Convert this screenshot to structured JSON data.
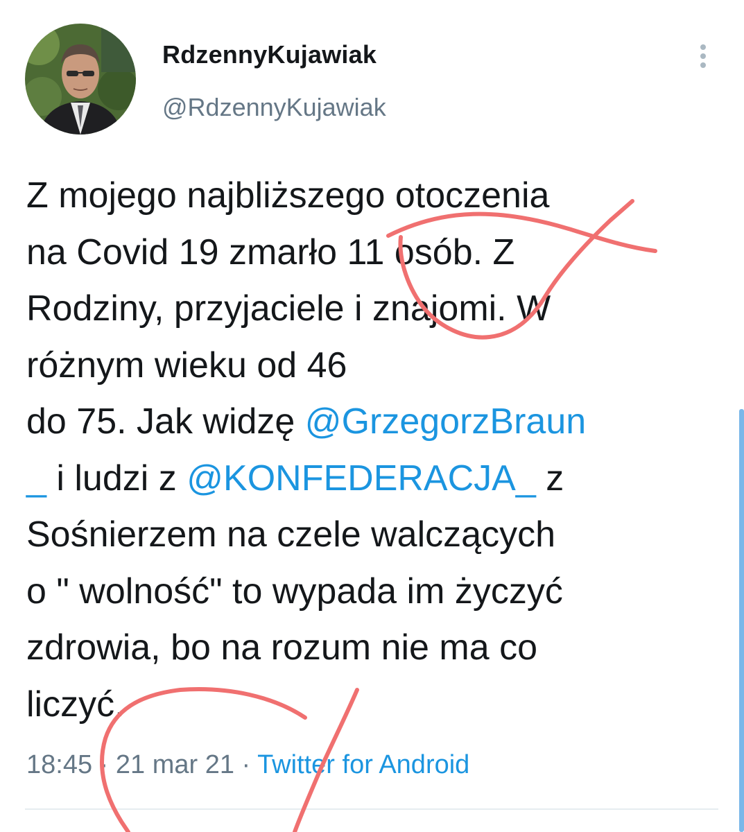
{
  "user": {
    "display_name": "RdzennyKujawiak",
    "handle": "@RdzennyKujawiak"
  },
  "tweet": {
    "lines": [
      [
        {
          "text": "Z mojego najbliższego otoczenia"
        }
      ],
      [
        {
          "text": "na Covid 19 zmarło 11 osób. Z"
        }
      ],
      [
        {
          "text": "Rodziny, przyjaciele i znajomi. W"
        }
      ],
      [
        {
          "text": "różnym wieku od 46"
        }
      ],
      [
        {
          "text": "do 75. Jak widzę "
        },
        {
          "text": "@GrzegorzBraun",
          "mention": true
        }
      ],
      [
        {
          "text": "_",
          "mention": true
        },
        {
          "text": " i ludzi z "
        },
        {
          "text": "@KONFEDERACJA_",
          "mention": true
        },
        {
          "text": "  z"
        }
      ],
      [
        {
          "text": "Sośnierzem na czele walczących"
        }
      ],
      [
        {
          "text": "o \" wolność\" to wypada im życzyć"
        }
      ],
      [
        {
          "text": "zdrowia, bo na rozum nie ma co"
        }
      ],
      [
        {
          "text": "liczyć."
        }
      ]
    ]
  },
  "meta": {
    "time": "18:45",
    "sep1": " · ",
    "date": "21 mar 21",
    "sep2": " · ",
    "source": "Twitter for Android"
  },
  "icons": {
    "more": "more-vertical-icon"
  },
  "colors": {
    "link": "#1b95e0",
    "secondary": "#657786",
    "annotation": "#f07070"
  }
}
